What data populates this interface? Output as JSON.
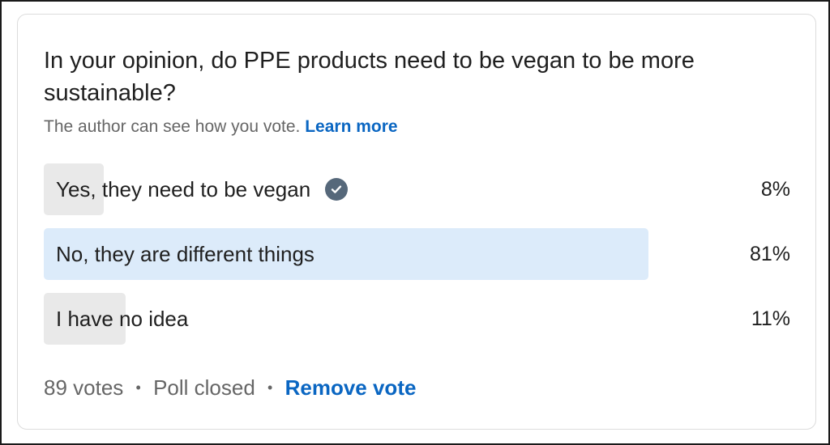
{
  "poll": {
    "question": "In your opinion, do PPE products need to be vegan to be more sustainable?",
    "privacy_note": "The author can see how you vote.",
    "learn_more_label": "Learn more",
    "options": [
      {
        "label": "Yes, they need to be vegan",
        "percent_label": "8%",
        "share": 0.08,
        "user_vote": true,
        "bar_color": "#e9e9e9"
      },
      {
        "label": "No, they are different things",
        "percent_label": "81%",
        "share": 0.81,
        "user_vote": false,
        "bar_color": "#dcebfa"
      },
      {
        "label": "I have no idea",
        "percent_label": "11%",
        "share": 0.11,
        "user_vote": false,
        "bar_color": "#e9e9e9"
      }
    ],
    "vote_count": "89 votes",
    "status": "Poll closed",
    "separator": "•",
    "remove_vote_label": "Remove vote",
    "check_icon": "check-circle-icon"
  },
  "colors": {
    "link": "#0a66c2",
    "muted_text": "#666666",
    "check_badge": "#56687a"
  }
}
